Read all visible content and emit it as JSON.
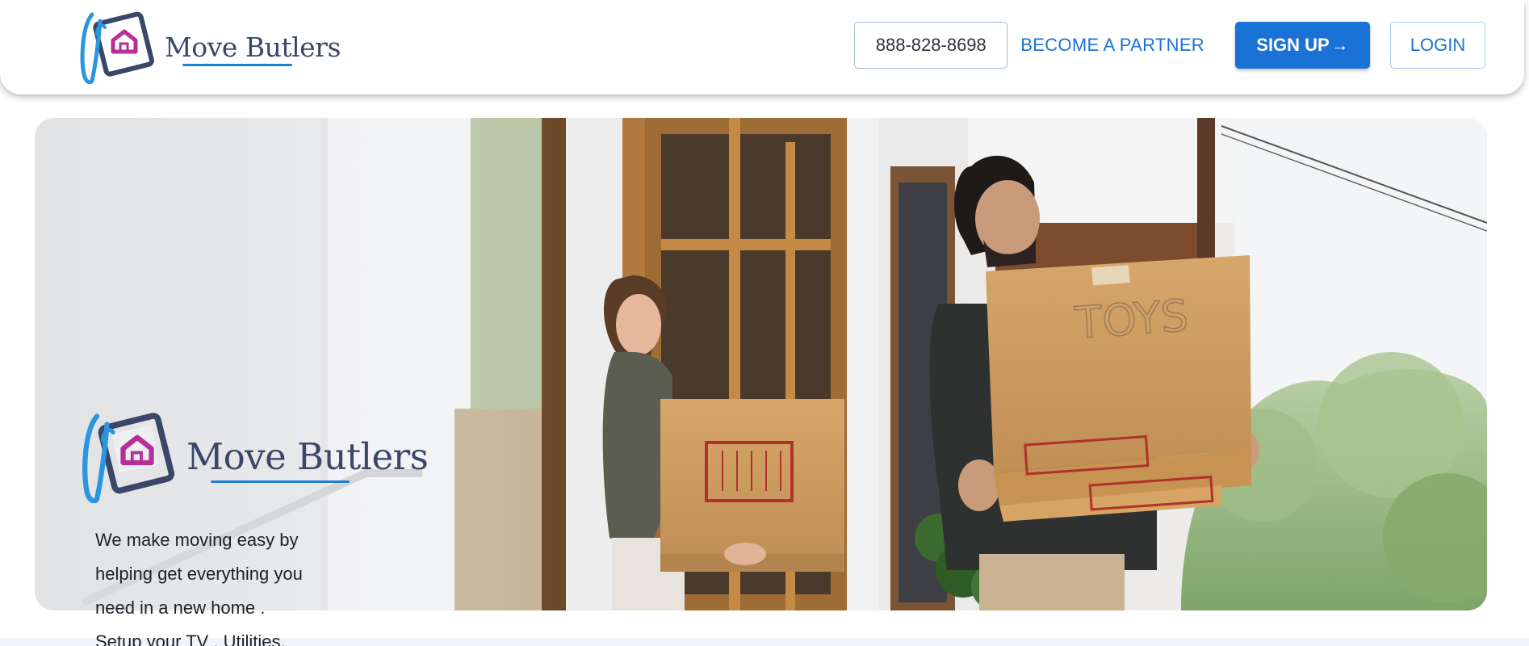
{
  "colors": {
    "brand_blue": "#1b72d6",
    "brand_navy": "#3b4768",
    "brand_magenta": "#b5309a"
  },
  "header": {
    "logo": {
      "text": "Move Butlers",
      "icon": "house-card-icon"
    },
    "nav": {
      "phone": "888-828-8698",
      "partner": "BECOME A PARTNER",
      "signup": "SIGN UP",
      "signup_icon": "arrow-right-icon",
      "login": "LOGIN"
    }
  },
  "hero": {
    "logo": {
      "text": "Move Butlers",
      "icon": "house-card-icon"
    },
    "tagline_lines": [
      "We make moving easy by",
      "helping get everything you",
      "need in a new home .",
      "Setup your TV , Utilities,"
    ],
    "box_label": "TOYS"
  }
}
